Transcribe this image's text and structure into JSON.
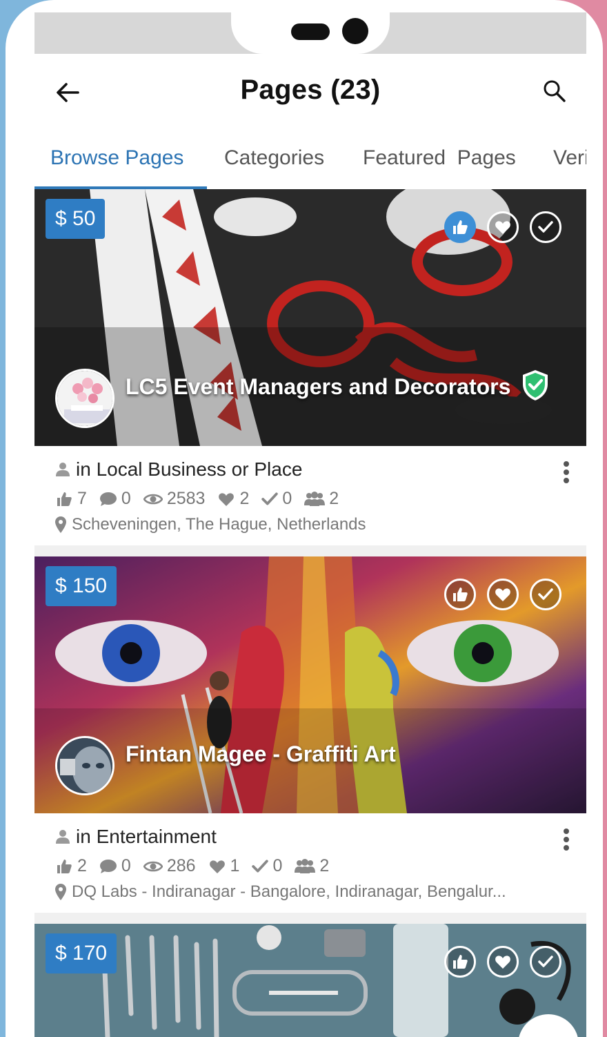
{
  "header": {
    "title": "Pages (23)"
  },
  "tabs": [
    {
      "label": "Browse Pages",
      "active": true
    },
    {
      "label": "Categories",
      "active": false
    },
    {
      "label": "Featured  Pages",
      "active": false
    },
    {
      "label": "Verified Pages",
      "active": false
    }
  ],
  "cards": [
    {
      "price": "$ 50",
      "name": "LC5 Event Managers and Decorators",
      "verified": true,
      "liked": true,
      "category": "in Local Business or Place",
      "likes": "7",
      "comments": "0",
      "views": "2583",
      "favorites": "2",
      "follows": "0",
      "members": "2",
      "location": "Scheveningen, The Hague, Netherlands"
    },
    {
      "price": "$ 150",
      "name": "Fintan Magee - Graffiti Art",
      "verified": false,
      "liked": false,
      "category": "in Entertainment",
      "likes": "2",
      "comments": "0",
      "views": "286",
      "favorites": "1",
      "follows": "0",
      "members": "2",
      "location": "DQ Labs - Indiranagar - Bangalore, Indiranagar, Bengalur..."
    },
    {
      "price": "$ 170",
      "liked": false
    }
  ],
  "colors": {
    "accent": "#2f7dc4",
    "tab_active": "#2b73b3",
    "verified": "#2fbf71"
  },
  "icons": [
    "back-arrow-icon",
    "search-icon",
    "like-icon",
    "heart-icon",
    "check-icon",
    "user-icon",
    "comment-icon",
    "eye-icon",
    "members-icon",
    "map-pin-icon",
    "more-vertical-icon",
    "verified-shield-icon"
  ]
}
